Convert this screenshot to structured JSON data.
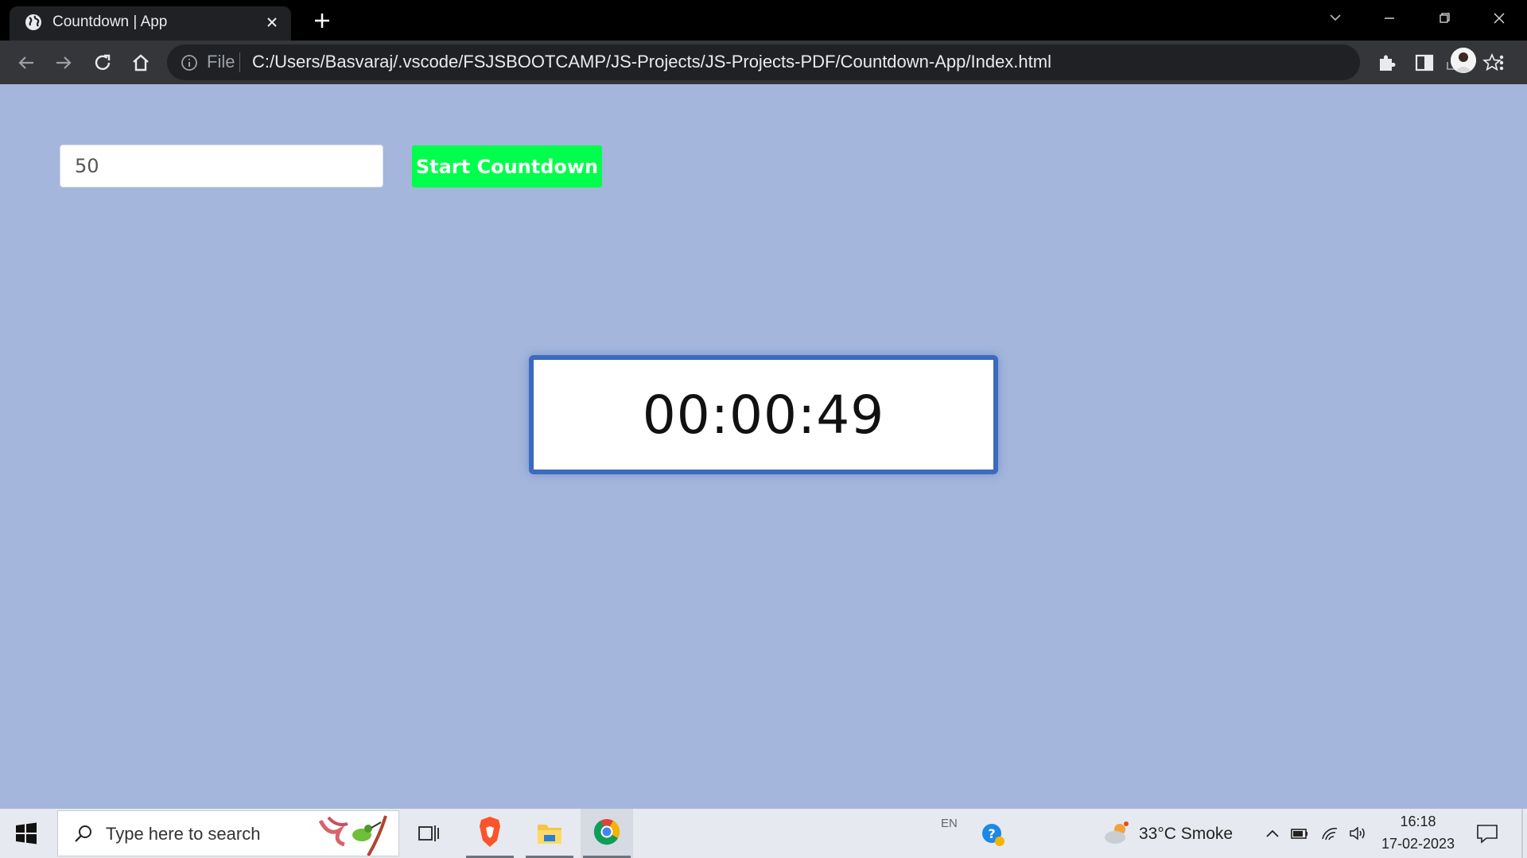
{
  "browser": {
    "tab_title": "Countdown | App",
    "file_label": "File",
    "url": "C:/Users/Basvaraj/.vscode/FSJSBOOTCAMP/JS-Projects/JS-Projects-PDF/Countdown-App/Index.html"
  },
  "app": {
    "input_value": "50",
    "start_label": "Start Countdown",
    "timer": "00:00:49"
  },
  "taskbar": {
    "search_placeholder": "Type here to search",
    "lang": "EN",
    "weather": "33°C  Smoke",
    "time": "16:18",
    "date": "17-02-2023"
  },
  "colors": {
    "page_bg": "#a4b6db",
    "button_bg": "#00ff4c",
    "timer_border": "#3b6abf"
  }
}
